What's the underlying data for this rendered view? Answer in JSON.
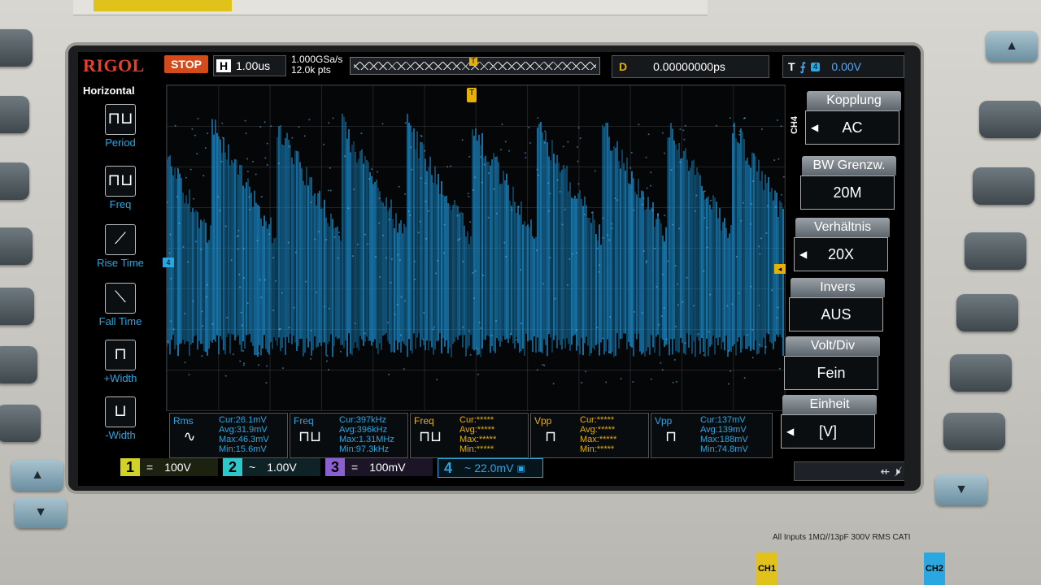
{
  "colors": {
    "brand": "#e8402a",
    "stop": "#d44a1a",
    "ch1": "#d2d12a",
    "ch2": "#2ec6c6",
    "ch3": "#8a5fd0",
    "ch4": "#2aa6e0",
    "trigger": "#e6b100",
    "trace": "#1a8fd0"
  },
  "header": {
    "logo": "RIGOL",
    "run_state": "STOP",
    "timebase_label": "H",
    "timebase_value": "1.00us",
    "sample_rate": "1.000GSa/s",
    "mem_depth": "12.0k pts",
    "delay_label": "D",
    "delay_value": "0.00000000ps",
    "trigger_label": "T",
    "trigger_channel": "4",
    "trigger_level": "0.00V"
  },
  "left_menu": {
    "title": "Horizontal",
    "items": [
      {
        "label": "Period",
        "icon": "period-icon"
      },
      {
        "label": "Freq",
        "icon": "freq-icon"
      },
      {
        "label": "Rise Time",
        "icon": "rise-time-icon"
      },
      {
        "label": "Fall Time",
        "icon": "fall-time-icon"
      },
      {
        "label": "+Width",
        "icon": "pos-width-icon"
      },
      {
        "label": "-Width",
        "icon": "neg-width-icon"
      }
    ]
  },
  "right_menu": {
    "channel": "CH4",
    "items": [
      {
        "title": "Kopplung",
        "value": "AC",
        "has_arrow": true
      },
      {
        "title": "BW Grenzw.",
        "value": "20M",
        "has_arrow": false
      },
      {
        "title": "Verhältnis",
        "value": "20X",
        "has_arrow": true
      },
      {
        "title": "Invers",
        "value": "AUS",
        "has_arrow": false
      },
      {
        "title": "Volt/Div",
        "value": "Fein",
        "has_arrow": false
      },
      {
        "title": "Einheit",
        "value": "[V]",
        "has_arrow": true
      }
    ]
  },
  "measurements": [
    {
      "name": "Rms",
      "channel": "4",
      "icon": "rms-icon",
      "cur": "Cur:26.1mV",
      "avg": "Avg:31.9mV",
      "max": "Max:46.3mV",
      "min": "Min:15.6mV",
      "color": "blue"
    },
    {
      "name": "Freq",
      "channel": "4",
      "icon": "freq-meas-icon",
      "cur": "Cur:397kHz",
      "avg": "Avg:396kHz",
      "max": "Max:1.31MHz",
      "min": "Min:97.3kHz",
      "color": "blue"
    },
    {
      "name": "Freq",
      "channel": "1",
      "icon": "freq-meas-icon",
      "cur": "Cur:*****",
      "avg": "Avg:*****",
      "max": "Max:*****",
      "min": "Min:*****",
      "color": "yellow"
    },
    {
      "name": "Vpp",
      "channel": "1",
      "icon": "vpp-icon",
      "cur": "Cur:*****",
      "avg": "Avg:*****",
      "max": "Max:*****",
      "min": "Min:*****",
      "color": "yellow"
    },
    {
      "name": "Vpp",
      "channel": "4",
      "icon": "vpp-icon",
      "cur": "Cur:137mV",
      "avg": "Avg:139mV",
      "max": "Max:188mV",
      "min": "Min:74.8mV",
      "color": "blue"
    }
  ],
  "channels": [
    {
      "num": "1",
      "coupling": "=",
      "scale": "100V"
    },
    {
      "num": "2",
      "coupling": "~",
      "scale": "1.00V"
    },
    {
      "num": "3",
      "coupling": "=",
      "scale": "100mV"
    },
    {
      "num": "4",
      "coupling": "~",
      "scale": "22.0mV"
    }
  ],
  "footnote": "All Inputs 1MΩ//13pF 300V RMS CATI",
  "waveform": {
    "type": "noisy sawtooth",
    "cycles_visible": 9.5,
    "time_per_div": "1.00us"
  }
}
